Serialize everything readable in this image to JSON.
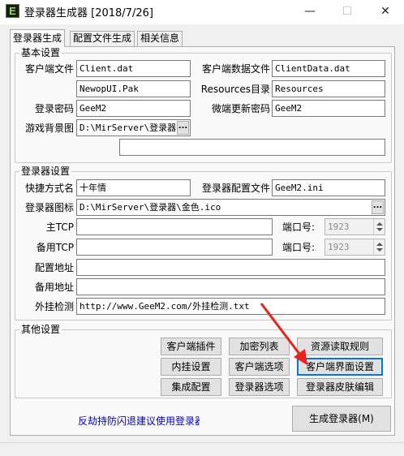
{
  "window": {
    "title": "登录器生成器 [2018/7/26]",
    "app_icon_letter": "E",
    "minimize": "—",
    "maximize": "☐",
    "close": "✕"
  },
  "tabs": [
    "登录器生成",
    "配置文件生成",
    "相关信息"
  ],
  "basic": {
    "title": "基本设置",
    "client_file_label": "客户端文件",
    "client_file_value": "Client.dat",
    "client_data_label": "客户端数据文件",
    "client_data_value": "ClientData.dat",
    "pak_value": "NewopUI.Pak",
    "resources_label": "Resources目录",
    "resources_value": "Resources",
    "password_label": "登录密码",
    "password_value": "GeeM2",
    "update_password_label": "微端更新密码",
    "update_password_value": "GeeM2",
    "bg_label": "游戏背景图",
    "bg_value": "D:\\MirServer\\登录器\\",
    "bg_browse": "...",
    "extra_value": ""
  },
  "launcher": {
    "title": "登录器设置",
    "shortcut_label": "快捷方式名",
    "shortcut_value": "十年情",
    "config_file_label": "登录器配置文件",
    "config_file_value": "GeeM2.ini",
    "icon_label": "登录器图标",
    "icon_value": "D:\\MirServer\\登录器\\金色.ico",
    "icon_browse": "...",
    "main_tcp_label": "主TCP",
    "main_tcp_value": "",
    "main_port_label": "端口号:",
    "main_port_value": "1923",
    "backup_tcp_label": "备用TCP",
    "backup_tcp_value": "",
    "backup_port_label": "端口号:",
    "backup_port_value": "1923",
    "config_addr_label": "配置地址",
    "config_addr_value": "",
    "backup_addr_label": "备用地址",
    "backup_addr_value": "",
    "cheat_check_label": "外挂检测",
    "cheat_check_value": "http://www.GeeM2.com/外挂检测.txt"
  },
  "other": {
    "title": "其他设置",
    "buttons": {
      "client_plugin": "客户端插件",
      "encrypt_list": "加密列表",
      "resource_rules": "资源读取规则",
      "internal_setting": "内挂设置",
      "client_options": "客户端选项",
      "client_ui_setting": "客户端界面设置",
      "integrated_config": "集成配置",
      "launcher_options": "登录器选项",
      "launcher_skin": "登录器皮肤编辑"
    }
  },
  "footer": {
    "notice": "反劫持防闪退建议使用登录器",
    "generate_button": "生成登录器(M)"
  },
  "colors": {
    "accent": "#0078d7",
    "arrow": "#e8231b",
    "link": "#0000cc"
  }
}
